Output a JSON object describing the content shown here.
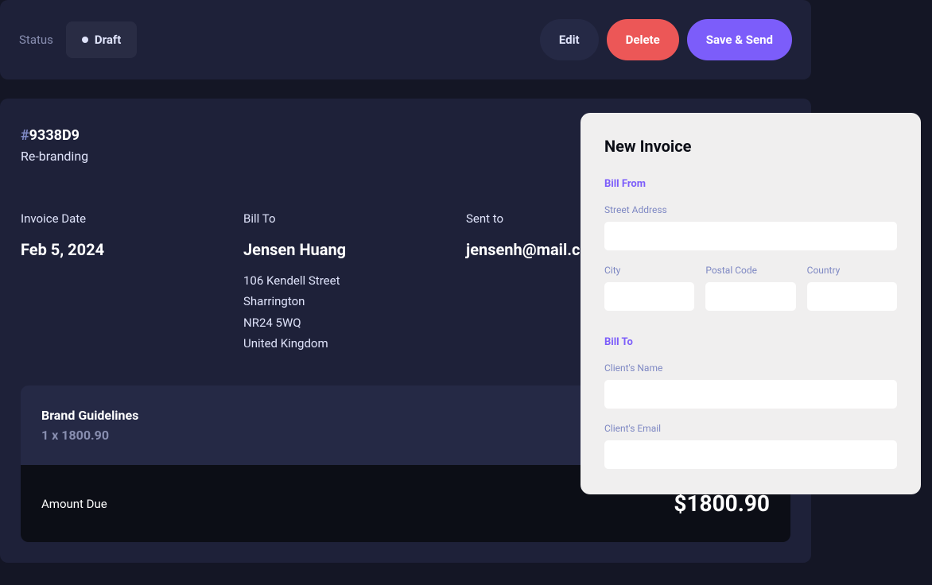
{
  "header": {
    "statusLabel": "Status",
    "statusValue": "Draft",
    "editLabel": "Edit",
    "deleteLabel": "Delete",
    "saveLabel": "Save & Send"
  },
  "invoice": {
    "id": "9338D9",
    "description": "Re-branding",
    "dateLabel": "Invoice Date",
    "dateValue": "Feb 5, 2024",
    "billToLabel": "Bill To",
    "clientName": "Jensen Huang",
    "addressStreet": "106 Kendell Street",
    "addressCity": "Sharrington",
    "addressPostcode": "NR24 5WQ",
    "addressCountry": "United Kingdom",
    "sentToLabel": "Sent to",
    "clientEmail": "jensenh@mail.com",
    "lineItemName": "Brand Guidelines",
    "lineItemQty": "1 x 1800.90",
    "amountDueLabel": "Amount Due",
    "amountDueValue": "$1800.90"
  },
  "modal": {
    "title": "New Invoice",
    "billFromLabel": "Bill From",
    "streetLabel": "Street Address",
    "cityLabel": "City",
    "postalLabel": "Postal Code",
    "countryLabel": "Country",
    "billToLabel": "Bill To",
    "clientNameLabel": "Client's Name",
    "clientEmailLabel": "Client's Email"
  }
}
